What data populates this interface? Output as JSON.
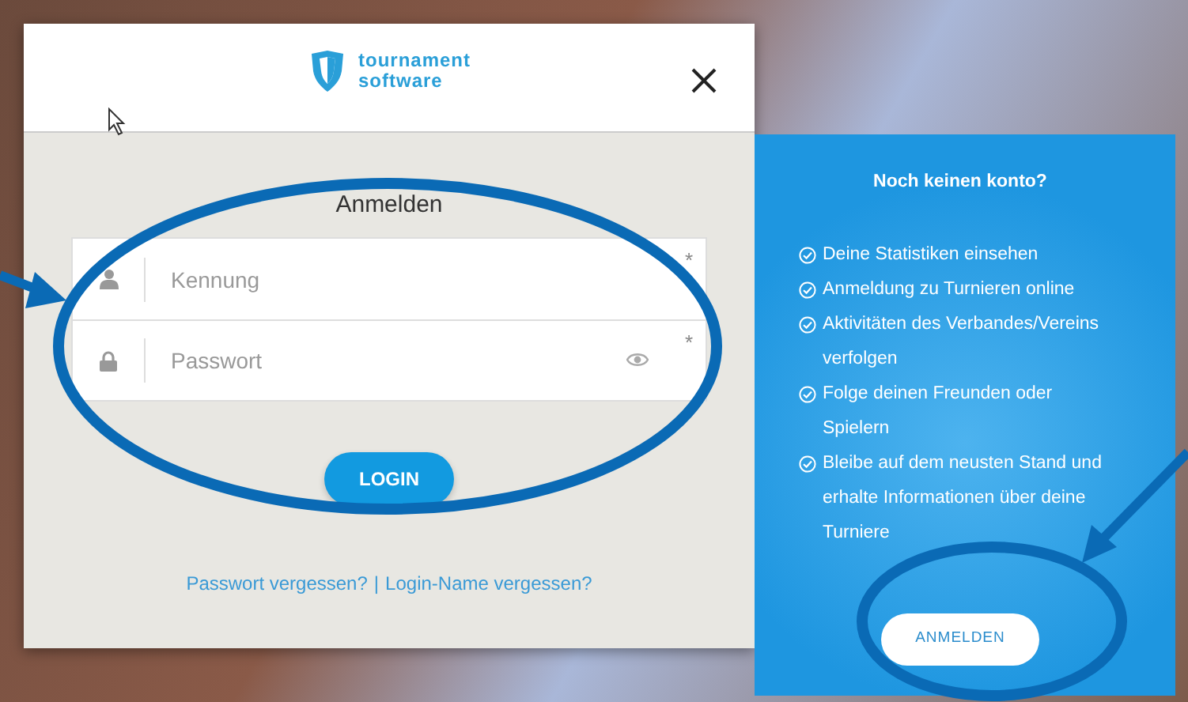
{
  "login_dialog": {
    "logo": [
      "tournament",
      "software"
    ],
    "title": "Anmelden",
    "fields": [
      {
        "kind": "text",
        "placeholder": "Kennung",
        "required_mark": "*"
      },
      {
        "kind": "password",
        "placeholder": "Passwort",
        "required_mark": "*"
      }
    ],
    "login_button": "LOGIN",
    "links": [
      "Passwort vergessen?",
      "Login-Name vergessen?"
    ],
    "link_separator": "|"
  },
  "register_panel": {
    "heading": "Noch keinen konto?",
    "features": [
      "Deine Statistiken einsehen",
      "Anmeldung zu Turnieren online",
      "Aktivitäten des Verbandes/Vereins verfolgen",
      "Folge deinen Freunden oder Spielern",
      "Bleibe auf dem neusten Stand und erhalte Informationen über deine Turniere"
    ],
    "button": "ANMELDEN"
  }
}
